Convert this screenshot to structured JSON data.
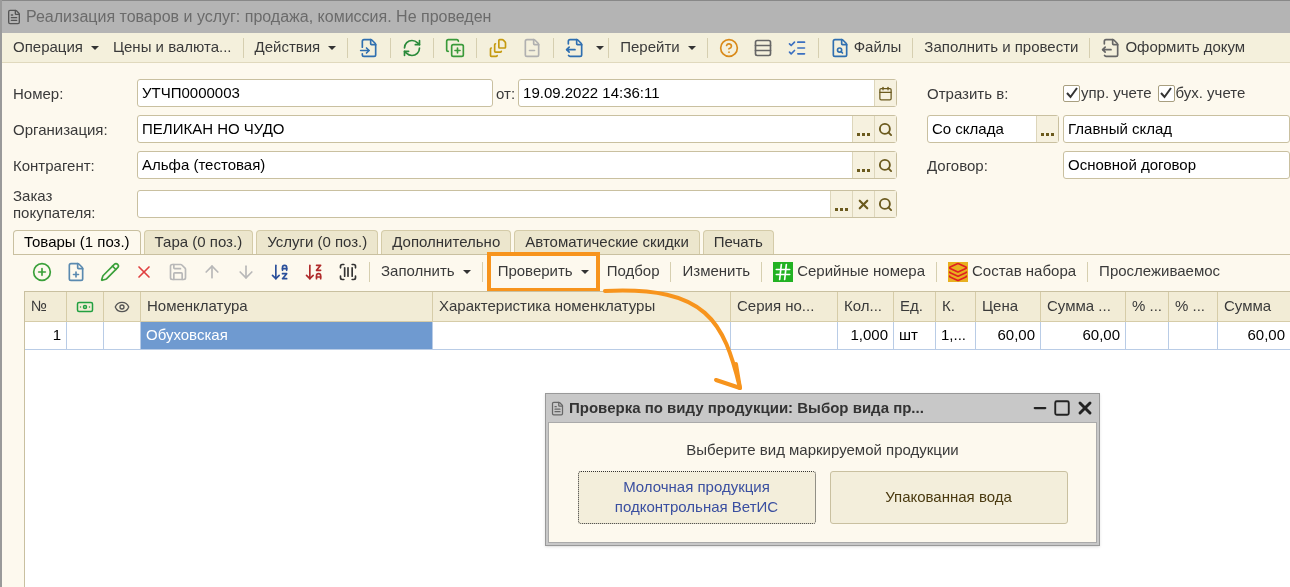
{
  "window": {
    "title": "Реализация товаров и услуг: продажа, комиссия. Не проведен"
  },
  "toolbar": {
    "operation_menu": "Операция",
    "prices": "Цены и валюта...",
    "actions_menu": "Действия",
    "goto_menu": "Перейти",
    "files": "Файлы",
    "fill_post": "Заполнить и провести",
    "create_doc": "Оформить докум"
  },
  "form": {
    "number": {
      "label": "Номер:",
      "value": "УТЧП0000003"
    },
    "date": {
      "label": "от:",
      "value": "19.09.2022 14:36:11"
    },
    "organization": {
      "label": "Организация:",
      "value": "ПЕЛИКАН НО ЧУДО"
    },
    "counterparty": {
      "label": "Контрагент:",
      "value": "Альфа (тестовая)"
    },
    "order": {
      "label": "Заказ покупателя:"
    },
    "reflect": {
      "label": "Отразить в:",
      "options": [
        {
          "label": "упр. учете",
          "checked": true
        },
        {
          "label": "бух. учете",
          "checked": true
        }
      ]
    },
    "warehouse": {
      "mode": "Со склада",
      "value": "Главный склад"
    },
    "contract": {
      "label": "Договор:",
      "value": "Основной договор"
    }
  },
  "tabs": [
    {
      "label": "Товары (1 поз.)",
      "selected": true
    },
    {
      "label": "Тара (0 поз.)",
      "selected": false
    },
    {
      "label": "Услуги (0 поз.)",
      "selected": false
    },
    {
      "label": "Дополнительно",
      "selected": false
    },
    {
      "label": "Автоматические скидки",
      "selected": false
    },
    {
      "label": "Печать",
      "selected": false
    }
  ],
  "table_toolbar": {
    "fill_menu": "Заполнить",
    "check_menu": "Проверить",
    "pick": "Подбор",
    "change": "Изменить",
    "serials": "Серийные номера",
    "kit": "Состав набора",
    "tracking": "Прослеживаемос"
  },
  "table": {
    "columns": [
      {
        "label": "№"
      },
      {
        "kind": "icon-money"
      },
      {
        "kind": "icon-view"
      },
      {
        "label": "Номенклатура"
      },
      {
        "label": "Характеристика номенклатуры"
      },
      {
        "label": "Серия но..."
      },
      {
        "label": "Кол..."
      },
      {
        "label": "Ед."
      },
      {
        "label": "К."
      },
      {
        "label": "Цена"
      },
      {
        "label": "Сумма ..."
      },
      {
        "label": "% ..."
      },
      {
        "label": "% ..."
      },
      {
        "label": "Сумма"
      }
    ],
    "rows": [
      {
        "cells": [
          {
            "text": "1",
            "selected": false
          },
          {
            "selected": false
          },
          {
            "selected": false
          },
          {
            "text": "Обуховская",
            "selected": true
          },
          {
            "selected": false
          },
          {
            "selected": false
          },
          {
            "text": "1,000",
            "selected": false
          },
          {
            "text": "шт",
            "selected": false
          },
          {
            "text": "1,...",
            "selected": false
          },
          {
            "text": "60,00",
            "selected": false
          },
          {
            "text": "60,00",
            "selected": false
          },
          {
            "selected": false
          },
          {
            "selected": false
          },
          {
            "text": "60,00",
            "selected": false
          }
        ]
      }
    ]
  },
  "dialog": {
    "title": "Проверка по виду продукции: Выбор вида пр...",
    "prompt": "Выберите вид маркируемой продукции",
    "buttons": [
      {
        "label": "Молочная продукция подконтрольная ВетИС",
        "focused": true
      },
      {
        "label": "Упакованная вода",
        "focused": false
      }
    ]
  }
}
